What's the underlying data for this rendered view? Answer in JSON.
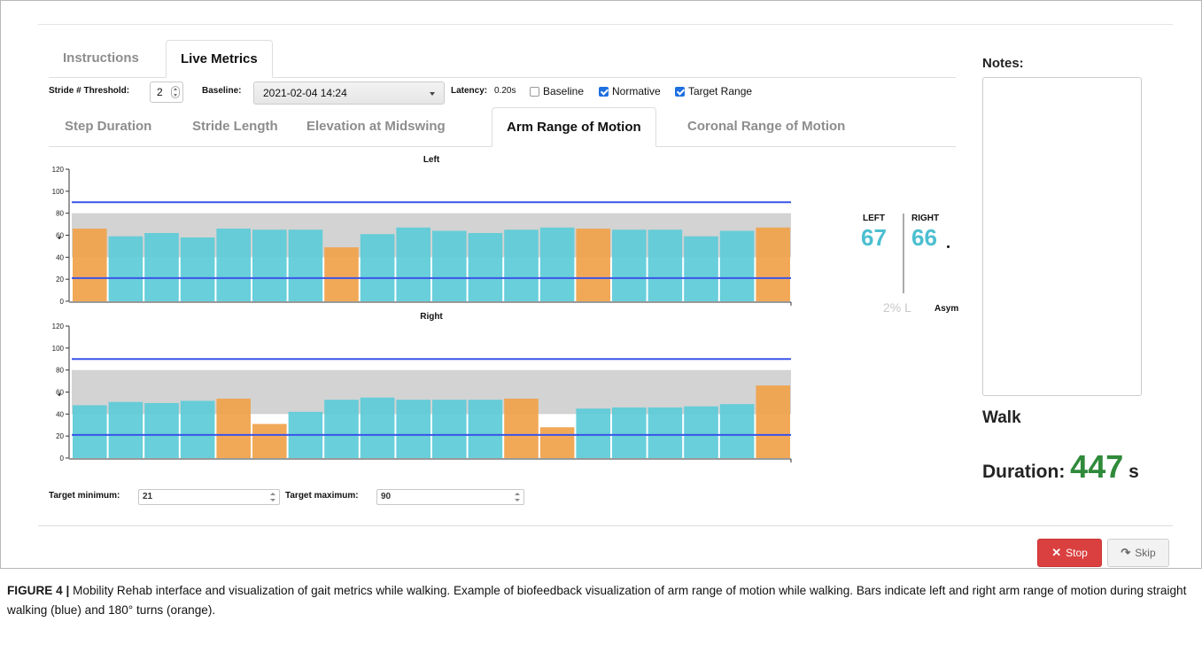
{
  "tabs": [
    {
      "label": "Instructions",
      "active": false
    },
    {
      "label": "Live Metrics",
      "active": true
    }
  ],
  "controls": {
    "stride_label": "Stride # Threshold:",
    "stride_value": "2",
    "baseline_label": "Baseline:",
    "baseline_value": "2021-02-04 14:24",
    "latency_label": "Latency:",
    "latency_value": "0.20s",
    "checkboxes": [
      {
        "label": "Baseline",
        "checked": false
      },
      {
        "label": "Normative",
        "checked": true
      },
      {
        "label": "Target Range",
        "checked": true
      }
    ]
  },
  "metric_tabs": [
    {
      "label": "Step Duration",
      "active": false
    },
    {
      "label": "Stride Length",
      "active": false
    },
    {
      "label": "Elevation at Midswing",
      "active": false
    },
    {
      "label": "Arm Range of Motion",
      "active": true
    },
    {
      "label": "Coronal Range of Motion",
      "active": false
    }
  ],
  "chart_data": [
    {
      "type": "bar",
      "title": "Left",
      "ylim": [
        0,
        120
      ],
      "yticks": [
        0,
        20,
        40,
        60,
        80,
        100,
        120
      ],
      "normative_band": [
        40,
        80
      ],
      "target_min": 21,
      "target_max": 90,
      "colors": {
        "walk": "#5bcbd8",
        "turn": "#f0a24a",
        "target_line": "#3a55e8",
        "band": "#d3d3d3"
      },
      "series": [
        {
          "values": [
            66,
            59,
            62,
            58,
            66,
            65,
            65,
            49,
            61,
            67,
            64,
            62,
            65,
            67,
            66,
            65,
            65,
            59,
            64,
            67
          ],
          "turn": [
            true,
            false,
            false,
            false,
            false,
            false,
            false,
            true,
            false,
            false,
            false,
            false,
            false,
            false,
            true,
            false,
            false,
            false,
            false,
            true
          ]
        }
      ]
    },
    {
      "type": "bar",
      "title": "Right",
      "ylim": [
        0,
        120
      ],
      "yticks": [
        0,
        20,
        40,
        60,
        80,
        100,
        120
      ],
      "normative_band": [
        40,
        80
      ],
      "target_min": 21,
      "target_max": 90,
      "colors": {
        "walk": "#5bcbd8",
        "turn": "#f0a24a",
        "target_line": "#3a55e8",
        "band": "#d3d3d3"
      },
      "series": [
        {
          "values": [
            48,
            51,
            50,
            52,
            54,
            31,
            42,
            53,
            55,
            53,
            53,
            53,
            54,
            28,
            45,
            46,
            46,
            47,
            49,
            66
          ],
          "turn": [
            false,
            false,
            false,
            false,
            true,
            true,
            false,
            false,
            false,
            false,
            false,
            false,
            true,
            true,
            false,
            false,
            false,
            false,
            false,
            true
          ]
        }
      ]
    }
  ],
  "summary": {
    "left_label": "LEFT",
    "right_label": "RIGHT",
    "left_value": "67",
    "right_value": "66",
    "asym_value": "2% L",
    "asym_label": "Asym"
  },
  "notes": {
    "label": "Notes:"
  },
  "walk": {
    "label": "Walk",
    "duration_label": "Duration:",
    "duration_value": "447",
    "duration_unit": "s"
  },
  "target": {
    "min_label": "Target minimum:",
    "min_value": "21",
    "max_label": "Target maximum:",
    "max_value": "90"
  },
  "buttons": {
    "stop_label": "Stop",
    "skip_label": "Skip"
  },
  "caption": {
    "figure": "FIGURE 4 |",
    "text": "Mobility Rehab interface and visualization of gait metrics while walking. Example of biofeedback visualization of arm range of motion while walking. Bars indicate left and right arm range of motion during straight walking (blue) and 180° turns (orange)."
  }
}
